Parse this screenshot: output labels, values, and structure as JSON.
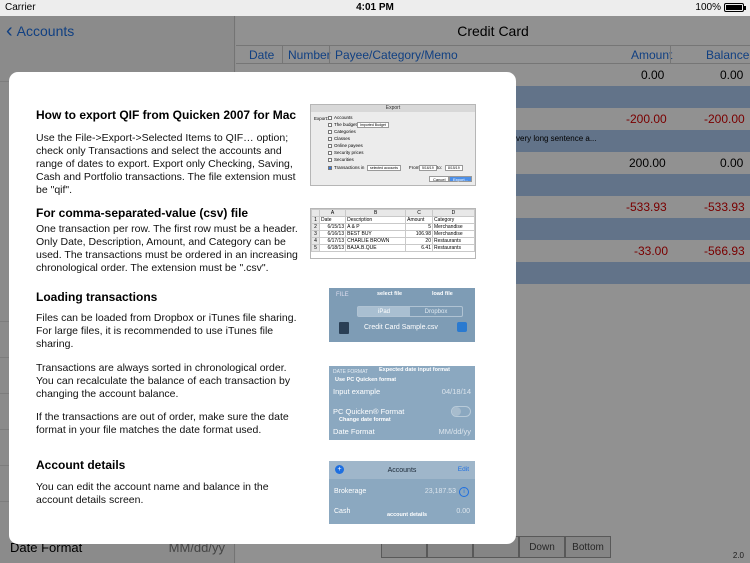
{
  "status": {
    "carrier": "Carrier",
    "time": "4:01 PM",
    "battery": "100%"
  },
  "sidebar": {
    "back_label": "Accounts",
    "date_format_label": "Date Format",
    "date_format_value": "MM/dd/yy"
  },
  "register": {
    "title": "Credit Card",
    "columns": {
      "date": "Date",
      "number": "Number",
      "payee": "Payee/Category/Memo",
      "amount": "Amount",
      "balance": "Balance"
    },
    "rows": [
      {
        "amount": "0.00",
        "balance": "0.00"
      },
      {
        "amount": "-200.00",
        "balance": "-200.00",
        "memo": "very long sentence a..."
      },
      {
        "amount": "200.00",
        "balance": "0.00"
      },
      {
        "amount": "-533.93",
        "balance": "-533.93"
      },
      {
        "amount": "-33.00",
        "balance": "-566.93"
      }
    ],
    "buttons": {
      "down": "Down",
      "bottom": "Bottom"
    },
    "version": "2.0"
  },
  "help": {
    "sections": [
      {
        "title": "How to export QIF from Quicken 2007 for Mac",
        "body": "Use the File->Export->Selected Items to QIF… option; check only Transactions and select the accounts and range of dates to export. Export only Checking, Saving, Cash and Portfolio transactions. The file extension must be \"qif\"."
      },
      {
        "title": "For comma-separated-value (csv) file",
        "body": "One transaction per row. The first row must be a header. Only Date, Description, Amount, and Category can be used. The transactions must be ordered in an increasing chronological order. The extension must be \".csv\"."
      },
      {
        "title": "Loading transactions",
        "body": "Files can be loaded from Dropbox or iTunes file sharing. For large files, it is recommended to use iTunes file sharing.",
        "body2": "Transactions are always sorted in chronological order. You can recalculate the balance of each transaction by changing the account balance.",
        "body3": "If the transactions are out of order, make sure the date format in your file matches the date format used."
      },
      {
        "title": "Account details",
        "body": "You can edit the account name and balance in the account details screen."
      }
    ],
    "export_fig": {
      "title": "Export",
      "label": "Export:",
      "options": [
        "Accounts",
        "The budget",
        "Categories",
        "Classes",
        "Online payees",
        "Security prices",
        "Securities",
        "Transactions in"
      ],
      "budget_select": "Imported Budget",
      "accounts_select": "selected accounts",
      "from": "From:",
      "from_date": "5/16/19",
      "to": "to:",
      "to_date": "8/15/19",
      "cancel": "Cancel",
      "export": "Export..."
    },
    "sheet_fig": {
      "col_letters": [
        "A",
        "B",
        "C",
        "D"
      ],
      "header": [
        "Date",
        "Description",
        "Amount",
        "Category"
      ],
      "rows": [
        [
          "6/15/13",
          "A & P",
          "5",
          "Merchandise"
        ],
        [
          "6/16/13",
          "BEST BUY",
          "106.98",
          "Merchandise"
        ],
        [
          "6/17/13",
          "CHARLIE BROWN",
          "20",
          "Restaurants"
        ],
        [
          "6/18/13",
          "BAJA.B.QUE",
          "6.41",
          "Restaurants"
        ]
      ]
    },
    "file_fig": {
      "section": "FILE",
      "itunes": "iPad",
      "dropbox": "Dropbox",
      "file_name": "Credit Card Sample.csv",
      "anno_select": "select file",
      "anno_load": "load file"
    },
    "date_fig": {
      "section": "DATE FORMAT",
      "anno_expected": "Expected date input format",
      "anno_pc": "Use PC Quicken format",
      "input_example_label": "Input example",
      "input_example_value": "04/18/14",
      "pc_label": "PC Quicken® Format",
      "anno_change": "Change date format",
      "date_format_label": "Date Format",
      "date_format_value": "MM/dd/yy"
    },
    "acct_fig": {
      "title": "Accounts",
      "edit": "Edit",
      "rows": [
        {
          "name": "Brokerage",
          "value": "23,187.53"
        },
        {
          "name": "Cash",
          "value": "0.00"
        }
      ],
      "anno": "account details"
    }
  }
}
